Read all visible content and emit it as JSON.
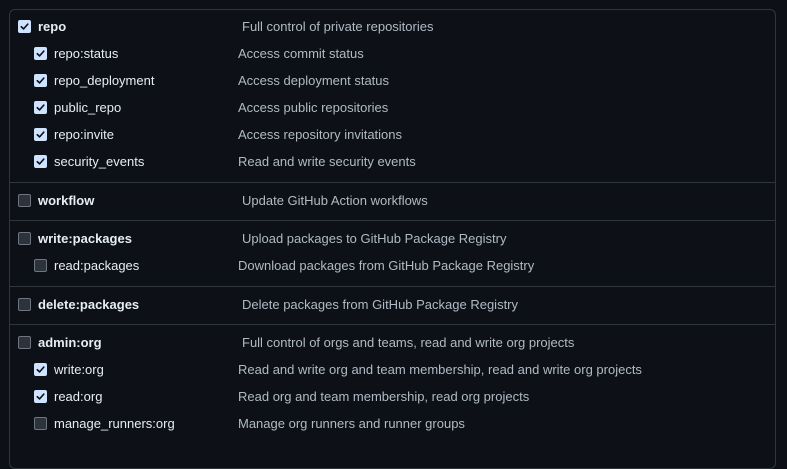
{
  "scopes": [
    {
      "name": "repo",
      "desc": "Full control of private repositories",
      "checked": true,
      "children": [
        {
          "name": "repo:status",
          "desc": "Access commit status",
          "checked": true
        },
        {
          "name": "repo_deployment",
          "desc": "Access deployment status",
          "checked": true
        },
        {
          "name": "public_repo",
          "desc": "Access public repositories",
          "checked": true
        },
        {
          "name": "repo:invite",
          "desc": "Access repository invitations",
          "checked": true
        },
        {
          "name": "security_events",
          "desc": "Read and write security events",
          "checked": true
        }
      ]
    },
    {
      "name": "workflow",
      "desc": "Update GitHub Action workflows",
      "checked": false,
      "children": []
    },
    {
      "name": "write:packages",
      "desc": "Upload packages to GitHub Package Registry",
      "checked": false,
      "children": [
        {
          "name": "read:packages",
          "desc": "Download packages from GitHub Package Registry",
          "checked": false
        }
      ]
    },
    {
      "name": "delete:packages",
      "desc": "Delete packages from GitHub Package Registry",
      "checked": false,
      "children": []
    },
    {
      "name": "admin:org",
      "desc": "Full control of orgs and teams, read and write org projects",
      "checked": false,
      "children": [
        {
          "name": "write:org",
          "desc": "Read and write org and team membership, read and write org projects",
          "checked": true
        },
        {
          "name": "read:org",
          "desc": "Read org and team membership, read org projects",
          "checked": true
        },
        {
          "name": "manage_runners:org",
          "desc": "Manage org runners and runner groups",
          "checked": false
        }
      ]
    }
  ],
  "colors": {
    "check_bg": "#cfe3ff",
    "check_mark": "#0d1117",
    "border": "#30363d"
  },
  "icons": {
    "checked": "checkmark-icon"
  }
}
